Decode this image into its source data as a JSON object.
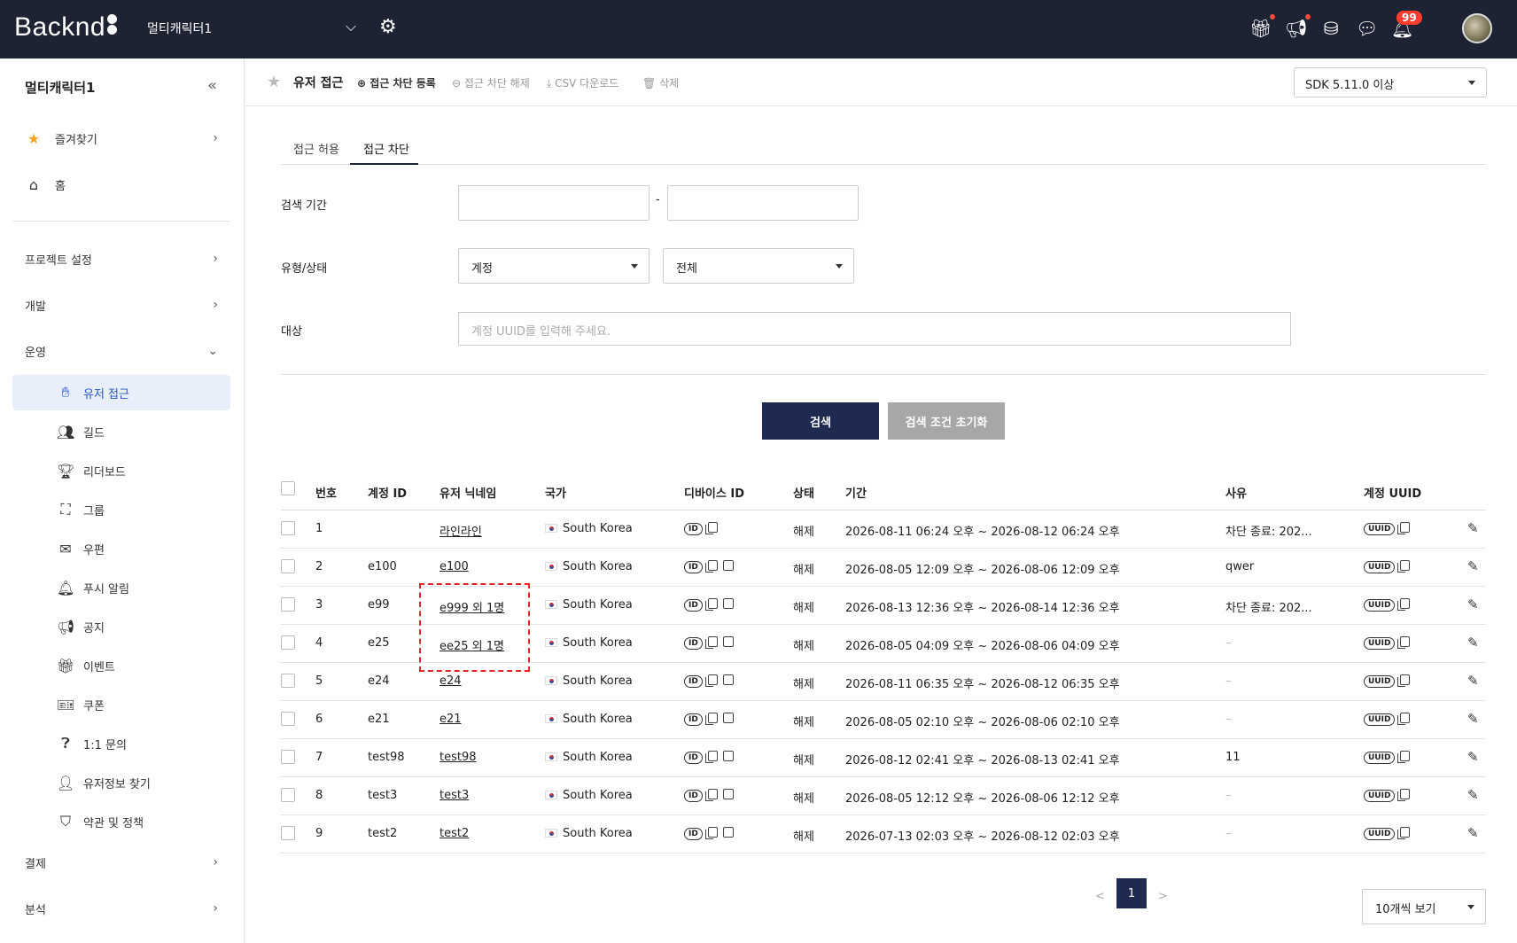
{
  "topbar": {
    "logo": "Backnd",
    "project_name": "멀티캐릭터1",
    "notification_count": "99"
  },
  "sidebar": {
    "title": "멀티캐릭터1",
    "items": [
      {
        "label": "즐겨찾기",
        "icon": "star-icon"
      },
      {
        "label": "홈",
        "icon": "home-icon"
      },
      {
        "label": "프로젝트 설정"
      },
      {
        "label": "개발"
      },
      {
        "label": "운영"
      },
      {
        "label": "유저 접근",
        "icon": "hand-icon"
      },
      {
        "label": "길드",
        "icon": "users-icon"
      },
      {
        "label": "리더보드",
        "icon": "trophy-icon"
      },
      {
        "label": "그룹",
        "icon": "group-icon"
      },
      {
        "label": "우편",
        "icon": "mail-icon"
      },
      {
        "label": "푸시 알림",
        "icon": "bell-icon"
      },
      {
        "label": "공지",
        "icon": "megaphone-icon"
      },
      {
        "label": "이벤트",
        "icon": "gift-icon"
      },
      {
        "label": "쿠폰",
        "icon": "ticket-icon"
      },
      {
        "label": "1:1 문의",
        "icon": "question-icon"
      },
      {
        "label": "유저정보 찾기",
        "icon": "user-search-icon"
      },
      {
        "label": "약관 및 정책",
        "icon": "shield-icon"
      },
      {
        "label": "결제"
      },
      {
        "label": "분석"
      }
    ]
  },
  "toolbar": {
    "title": "유저 접근",
    "register": "접근 차단 등록",
    "release": "접근 차단 해제",
    "csv": "CSV 다운로드",
    "delete": "삭제",
    "sdk": "SDK 5.11.0 이상"
  },
  "tabs": [
    "접근 허용",
    "접근 차단"
  ],
  "filters": {
    "period_label": "검색 기간",
    "period_sep": "-",
    "type_label": "유형/상태",
    "type_value": "계정",
    "status_value": "전체",
    "target_label": "대상",
    "target_placeholder": "계정 UUID를 입력해 주세요.",
    "search_btn": "검색",
    "reset_btn": "검색 조건 초기화"
  },
  "table": {
    "headers": [
      "번호",
      "계정 ID",
      "유저 닉네임",
      "국가",
      "디바이스 ID",
      "상태",
      "기간",
      "사유",
      "계정 UUID"
    ],
    "id_badge": "ID",
    "uuid_badge": "UUID",
    "rows": [
      {
        "no": "1",
        "account": "",
        "nick": "라인라인",
        "country": "South Korea",
        "note": false,
        "status": "해제",
        "period": "2026-08-11 06:24 오후 ~ 2026-08-12 06:24 오후",
        "reason": "차단 종료: 202..."
      },
      {
        "no": "2",
        "account": "e100",
        "nick": "e100",
        "country": "South Korea",
        "note": true,
        "status": "해제",
        "period": "2026-08-05 12:09 오후 ~ 2026-08-06 12:09 오후",
        "reason": "qwer"
      },
      {
        "no": "3",
        "account": "e99",
        "nick": "e999 외 1명",
        "country": "South Korea",
        "note": true,
        "status": "해제",
        "period": "2026-08-13 12:36 오후 ~ 2026-08-14 12:36 오후",
        "reason": "차단 종료: 202..."
      },
      {
        "no": "4",
        "account": "e25",
        "nick": "ee25 외 1명",
        "country": "South Korea",
        "note": true,
        "status": "해제",
        "period": "2026-08-05 04:09 오후 ~ 2026-08-06 04:09 오후",
        "reason": "–"
      },
      {
        "no": "5",
        "account": "e24",
        "nick": "e24",
        "country": "South Korea",
        "note": true,
        "status": "해제",
        "period": "2026-08-11 06:35 오후 ~ 2026-08-12 06:35 오후",
        "reason": "–"
      },
      {
        "no": "6",
        "account": "e21",
        "nick": "e21",
        "country": "South Korea",
        "note": true,
        "status": "해제",
        "period": "2026-08-05 02:10 오후 ~ 2026-08-06 02:10 오후",
        "reason": "–"
      },
      {
        "no": "7",
        "account": "test98",
        "nick": "test98",
        "country": "South Korea",
        "note": true,
        "status": "해제",
        "period": "2026-08-12 02:41 오후 ~ 2026-08-13 02:41 오후",
        "reason": "11"
      },
      {
        "no": "8",
        "account": "test3",
        "nick": "test3",
        "country": "South Korea",
        "note": true,
        "status": "해제",
        "period": "2026-08-05 12:12 오후 ~ 2026-08-06 12:12 오후",
        "reason": "–"
      },
      {
        "no": "9",
        "account": "test2",
        "nick": "test2",
        "country": "South Korea",
        "note": true,
        "status": "해제",
        "period": "2026-07-13 02:03 오후 ~ 2026-08-12 02:03 오후",
        "reason": "–"
      }
    ]
  },
  "pagination": {
    "prev": "<",
    "current": "1",
    "next": ">",
    "page_size": "10개씩 보기"
  },
  "colors": {
    "topbar": "#1e2334",
    "primary_button": "#1e2a4f",
    "active_nav": "#2a56c6",
    "highlight_box": "#e0242a"
  }
}
